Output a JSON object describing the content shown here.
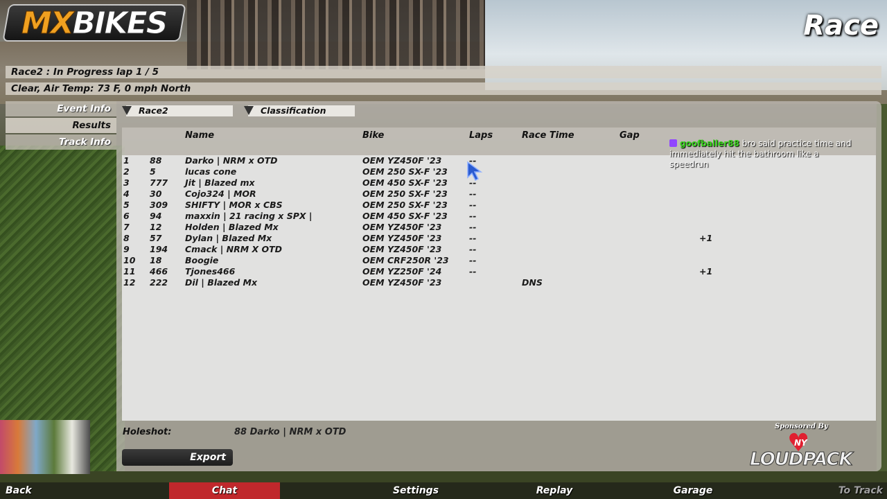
{
  "app": {
    "logo_mx": "MX",
    "logo_bikes": "BIKES",
    "page_title": "Race"
  },
  "status": {
    "session_line": "Race2 : In Progress  lap 1 / 5",
    "conditions_line": "Clear, Air Temp: 73 F, 0 mph North"
  },
  "sidebar": {
    "items": [
      {
        "label": "Event Info"
      },
      {
        "label": "Results"
      },
      {
        "label": "Track Info"
      }
    ]
  },
  "filters": {
    "session": "Race2",
    "view": "Classification"
  },
  "table": {
    "headers": {
      "name": "Name",
      "bike": "Bike",
      "laps": "Laps",
      "race_time": "Race Time",
      "gap": "Gap"
    },
    "rows": [
      {
        "pos": "1",
        "num": "88",
        "name": "Darko | NRM x OTD",
        "bike": "OEM YZ450F '23",
        "laps": "--",
        "time": "",
        "gap": ""
      },
      {
        "pos": "2",
        "num": "5",
        "name": "lucas cone",
        "bike": "OEM 250 SX-F '23",
        "laps": "--",
        "time": "",
        "gap": ""
      },
      {
        "pos": "3",
        "num": "777",
        "name": "Jit | Blazed mx",
        "bike": "OEM 450 SX-F '23",
        "laps": "--",
        "time": "",
        "gap": ""
      },
      {
        "pos": "4",
        "num": "30",
        "name": "Cojo324 | MOR",
        "bike": "OEM 250 SX-F '23",
        "laps": "--",
        "time": "",
        "gap": ""
      },
      {
        "pos": "5",
        "num": "309",
        "name": "SHIFTY | MOR x CBS",
        "bike": "OEM 250 SX-F '23",
        "laps": "--",
        "time": "",
        "gap": ""
      },
      {
        "pos": "6",
        "num": "94",
        "name": "maxxin | 21 racing x SPX |",
        "bike": "OEM 450 SX-F '23",
        "laps": "--",
        "time": "",
        "gap": ""
      },
      {
        "pos": "7",
        "num": "12",
        "name": "Holden | Blazed Mx",
        "bike": "OEM YZ450F '23",
        "laps": "--",
        "time": "",
        "gap": ""
      },
      {
        "pos": "8",
        "num": "57",
        "name": "Dylan | Blazed Mx",
        "bike": "OEM YZ450F '23",
        "laps": "--",
        "time": "",
        "gap": "+1"
      },
      {
        "pos": "9",
        "num": "194",
        "name": "Cmack | NRM X OTD",
        "bike": "OEM YZ450F '23",
        "laps": "--",
        "time": "",
        "gap": ""
      },
      {
        "pos": "10",
        "num": "18",
        "name": "Boogie",
        "bike": "OEM CRF250R '23",
        "laps": "--",
        "time": "",
        "gap": ""
      },
      {
        "pos": "11",
        "num": "466",
        "name": "Tjones466",
        "bike": "OEM YZ250F '24",
        "laps": "--",
        "time": "",
        "gap": "+1"
      },
      {
        "pos": "12",
        "num": "222",
        "name": "Dil | Blazed Mx",
        "bike": "OEM YZ450F '23",
        "laps": "",
        "time": "DNS",
        "gap": ""
      }
    ]
  },
  "chat_overlay": {
    "user": "goofballer88",
    "message": "bro said practice time and immediately hit the bathroom like a speedrun"
  },
  "holeshot": {
    "label": "Holeshot:",
    "value": "88 Darko | NRM x OTD"
  },
  "actions": {
    "export": "Export"
  },
  "sponsor": {
    "by": "Sponsored By",
    "ny": "NY",
    "brand": "LOUDPACK"
  },
  "bottom_nav": {
    "back": "Back",
    "chat": "Chat",
    "settings": "Settings",
    "replay": "Replay",
    "garage": "Garage",
    "to_track": "To Track"
  },
  "colors": {
    "accent_red": "#c0282c",
    "twitch_purple": "#9146ff",
    "chat_user_green": "#3ad21e"
  }
}
